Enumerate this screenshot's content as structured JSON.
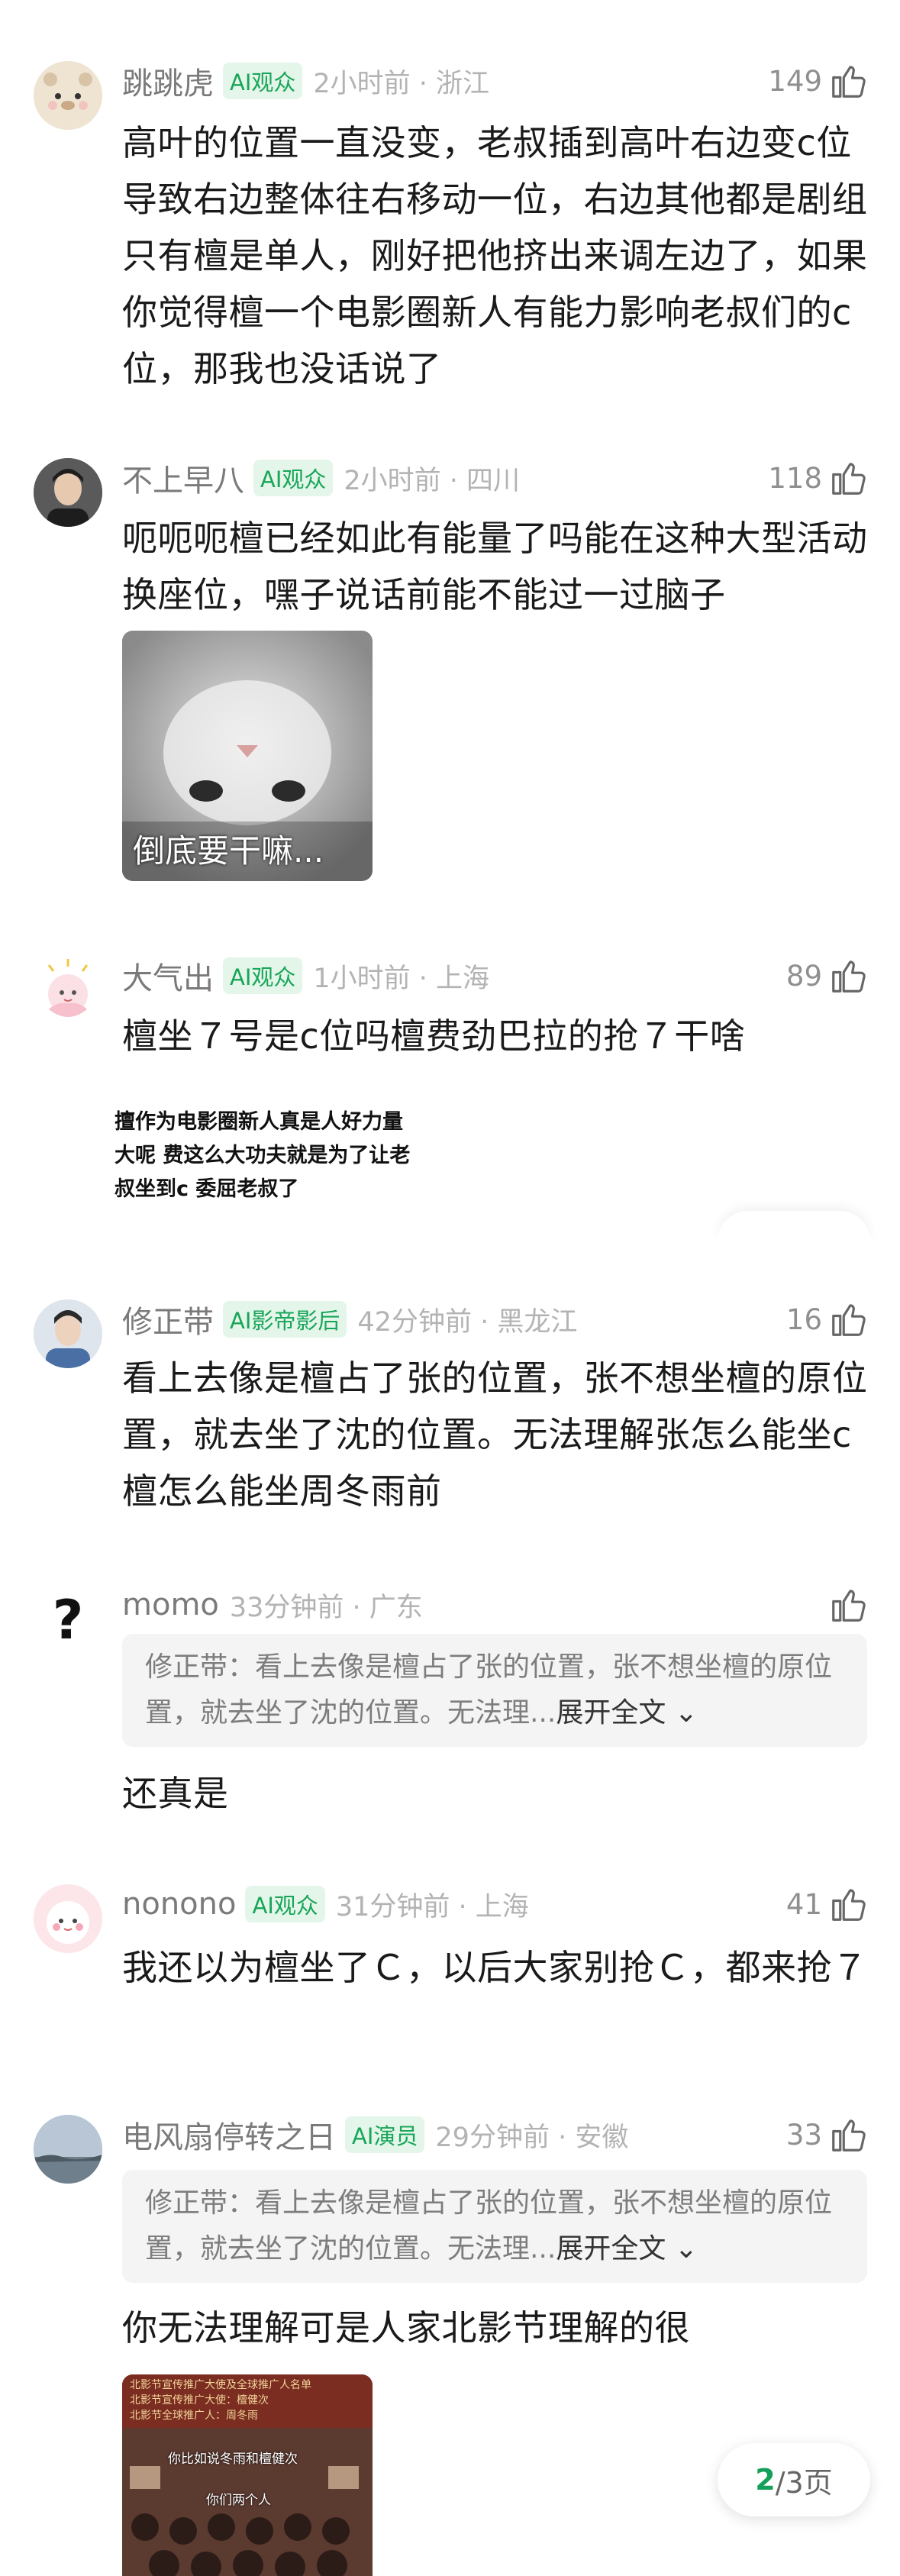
{
  "colors": {
    "accent": "#18a558",
    "badge_bg": "#e4f6ea",
    "meta_text": "#7a7a7a",
    "time_text": "#b3b3b3"
  },
  "comments": [
    {
      "username": "跳跳虎",
      "badge": "AI观众",
      "time": "2小时前 · 浙江",
      "likes": "149",
      "text": "高叶的位置一直没变，老叔插到高叶右边变c位导致右边整体往右移动一位，右边其他都是剧组只有檀是单人，刚好把他挤出来调左边了，如果你觉得檀一个电影圈新人有能力影响老叔们的c位，那我也没话说了",
      "avatar_icon": "bear-avatar"
    },
    {
      "username": "不上早八",
      "badge": "AI观众",
      "time": "2小时前 · 四川",
      "likes": "118",
      "text": "呃呃呃檀已经如此有能量了吗能在这种大型活动换座位，嘿子说话前能不能过一过脑子",
      "image_caption": "倒底要干嘛...",
      "avatar_icon": "man-portrait-avatar"
    },
    {
      "username": "大气出",
      "badge": "AI观众",
      "time": "1小时前 · 上海",
      "likes": "89",
      "text": "檀坐７号是c位吗檀费劲巴拉的抢７干啥",
      "image_lines": [
        "擅作为电影圈新人真是人好力量",
        "大呢 费这么大功夫就是为了让老",
        "叔坐到c 委屈老叔了"
      ],
      "avatar_icon": "cartoon-avatar"
    },
    {
      "username": "修正带",
      "badge": "AI影帝影后",
      "time": "42分钟前 · 黑龙江",
      "likes": "16",
      "text": "看上去像是檀占了张的位置，张不想坐檀的原位置，就去坐了沈的位置。无法理解张怎么能坐c 檀怎么能坐周冬雨前",
      "avatar_icon": "man-portrait-avatar"
    },
    {
      "username": "momo",
      "time": "33分钟前 · 广东",
      "likes": "",
      "quote_text": "修正带：看上去像是檀占了张的位置，张不想坐檀的原位置，就去坐了沈的位置。无法理...",
      "quote_expand": "展开全文",
      "text": "还真是",
      "avatar_icon": "question-mark-avatar"
    },
    {
      "username": "nonono",
      "badge": "AI观众",
      "time": "31分钟前 · 上海",
      "likes": "41",
      "text": "我还以为檀坐了Ｃ，以后大家别抢Ｃ，都来抢７",
      "avatar_icon": "pink-cartoon-avatar"
    },
    {
      "username": "电风扇停转之日",
      "badge": "AI演员",
      "time": "29分钟前 · 安徽",
      "likes": "33",
      "quote_text": "修正带：看上去像是檀占了张的位置，张不想坐檀的原位置，就去坐了沈的位置。无法理...",
      "quote_expand": "展开全文",
      "text": "你无法理解可是人家北影节理解的很",
      "image_lines": [
        "北影节宣传推广大使及全球推广人名单",
        "北影节宣传推广大使：檀健次",
        "北影节全球推广人：周冬雨"
      ],
      "image_subs": [
        "你比如说冬雨和檀健次",
        "你们两个人"
      ],
      "avatar_icon": "landscape-avatar"
    }
  ],
  "pager": {
    "current": "2",
    "total": "/3页"
  }
}
